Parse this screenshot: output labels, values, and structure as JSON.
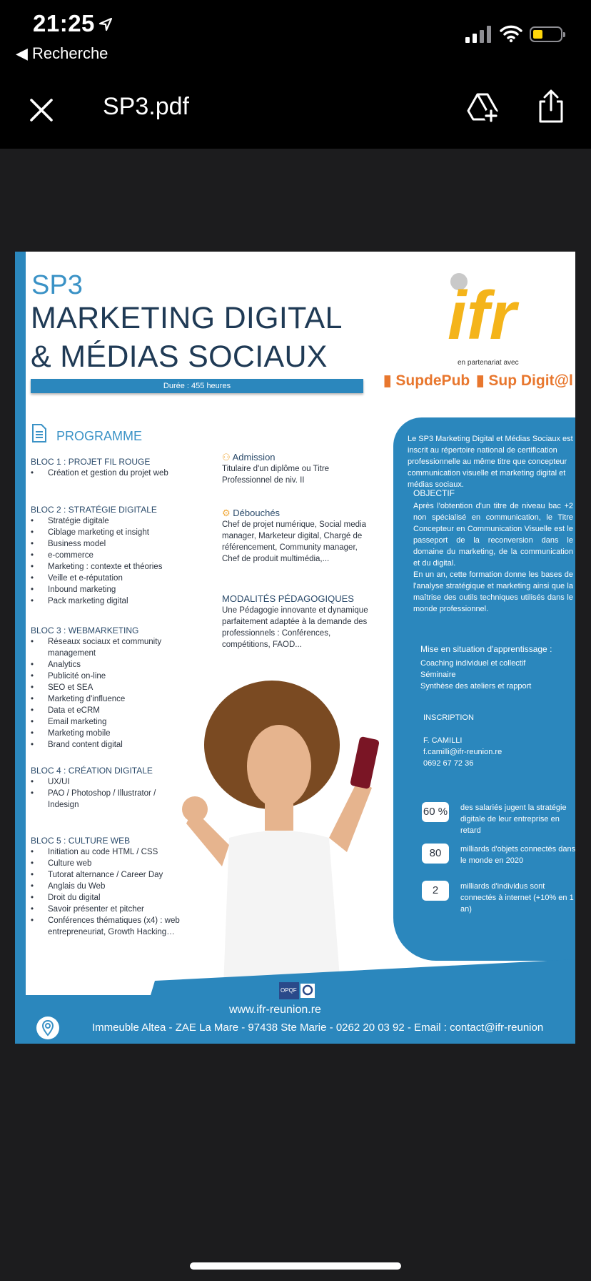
{
  "status_bar": {
    "time": "21:25",
    "back_label": "Recherche"
  },
  "nav": {
    "title": "SP3.pdf"
  },
  "pdf": {
    "sp3": "SP3",
    "title_line1": "MARKETING DIGITAL",
    "title_line2": "& MÉDIAS SOCIAUX",
    "duree": "Durée : 455 heures",
    "logo_text": "ifr",
    "partner_text": "en partenariat avec",
    "partner1": "SupdePub",
    "partner2": "Sup Digit@l",
    "programme_heading": "PROGRAMME",
    "blocs": [
      {
        "title": "BLOC 1 : PROJET FIL ROUGE",
        "items": [
          "Création et gestion du projet web"
        ]
      },
      {
        "title": "BLOC 2 : STRATÉGIE DIGITALE",
        "items": [
          "Stratégie digitale",
          "Ciblage marketing et insight",
          "Business model",
          "e-commerce",
          "Marketing : contexte et théories",
          "Veille et e-réputation",
          "Inbound marketing",
          "Pack marketing digital"
        ]
      },
      {
        "title": "BLOC 3 : WEBMARKETING",
        "items": [
          "Réseaux sociaux et community management",
          "Analytics",
          "Publicité on-line",
          "SEO et SEA",
          "Marketing d'influence",
          "Data et eCRM",
          "Email marketing",
          "Marketing mobile",
          "Brand content digital"
        ]
      },
      {
        "title": "BLOC 4 : CRÉATION DIGITALE",
        "items": [
          "UX/UI",
          "PAO / Photoshop / Illustrator / Indesign"
        ]
      },
      {
        "title": "BLOC 5 : CULTURE WEB",
        "items": [
          "Initiation au code HTML / CSS",
          "Culture web",
          "Tutorat alternance / Career Day",
          "Anglais du Web",
          "Droit du digital",
          "Savoir présenter et pitcher",
          "Conférences thématiques (x4) : web entrepreneuriat, Growth Hacking…"
        ]
      }
    ],
    "admission_h": "Admission",
    "admission_t": "Titulaire d'un diplôme ou Titre Professionnel de niv. II",
    "debouches_h": "Débouchés",
    "debouches_t": "Chef de projet numérique, Social media manager, Marketeur digital, Chargé de référencement, Community manager, Chef de produit multimédia,...",
    "modalites_h": "MODALITÉS PÉDAGOGIQUES",
    "modalites_t": "Une Pédagogie innovante et dynamique parfaitement adaptée à la demande des professionnels : Conférences, compétitions, FAOD...",
    "panel_intro": "Le SP3 Marketing Digital et Médias Sociaux est inscrit au répertoire national de certification professionnelle au même titre que concepteur communication visuelle et marketing digital et médias sociaux.",
    "objectif_h": "OBJECTIF",
    "objectif_t": "Après l'obtention d'un titre de niveau bac +2 non spécialisé en communication, le Titre Concepteur en Communication Visuelle est le passeport de la reconversion dans le domaine du marketing, de la communication et du digital.",
    "objectif_t2": "En un an, cette formation donne les bases de l'analyse stratégique et marketing ainsi que la maîtrise des outils techniques utilisés dans le monde professionnel.",
    "mise_h": "Mise en situation d'apprentissage :",
    "mise_items": [
      "Coaching individuel et collectif",
      "Séminaire",
      "Synthèse des ateliers et rapport"
    ],
    "inscription_h": "INSCRIPTION",
    "contact_name": "F. CAMILLI",
    "contact_email": "f.camilli@ifr-reunion.re",
    "contact_phone": "0692 67 72 36",
    "stats": [
      {
        "value": "60 %",
        "text": "des salariés jugent la stratégie digitale de leur entreprise en retard"
      },
      {
        "value": "80",
        "text": "milliards d'objets connectés dans le monde en 2020"
      },
      {
        "value": "2",
        "text": "milliards d'individus sont connectés à internet (+10% en 1 an)"
      }
    ],
    "opqf": "OPQF",
    "website": "www.ifr-reunion.re",
    "address": "Immeuble Altea - ZAE La Mare - 97438 Ste Marie - 0262 20 03 92 - Email : contact@ifr-reunion"
  }
}
